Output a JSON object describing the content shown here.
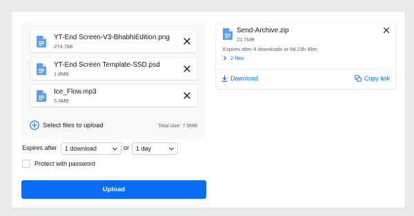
{
  "upload_panel": {
    "files": [
      {
        "name": "YT-End Screen-V3-BhabhiEdition.png",
        "size": "274.7kB"
      },
      {
        "name": "YT-End Screen Template-SSD.psd",
        "size": "1.8MB"
      },
      {
        "name": "Ice_Flow.mp3",
        "size": "5.4MB"
      }
    ],
    "add_files_label": "Select files to upload",
    "total_size": "Total size: 7.5MB"
  },
  "options": {
    "expires_label": "Expires after",
    "downloads_selected": "1 download",
    "or_label": "or",
    "time_selected": "1 day",
    "password_label": "Protect with password"
  },
  "upload_button": {
    "label": "Upload"
  },
  "archive": {
    "name": "Send-Archive.zip",
    "size": "21.7MB",
    "expiry": "Expires after 4 downloads or 6d 23h 48m",
    "files_toggle": "2 files",
    "download_label": "Download",
    "copy_link_label": "Copy link"
  },
  "colors": {
    "accent": "#0a6cf4",
    "file_icon": "#5a9ff0",
    "background": "#ebebeb"
  },
  "icons": [
    "document-icon",
    "close-icon",
    "plus-circle-icon",
    "chevron-down-icon",
    "chevron-right-icon",
    "download-icon",
    "copy-link-icon"
  ]
}
